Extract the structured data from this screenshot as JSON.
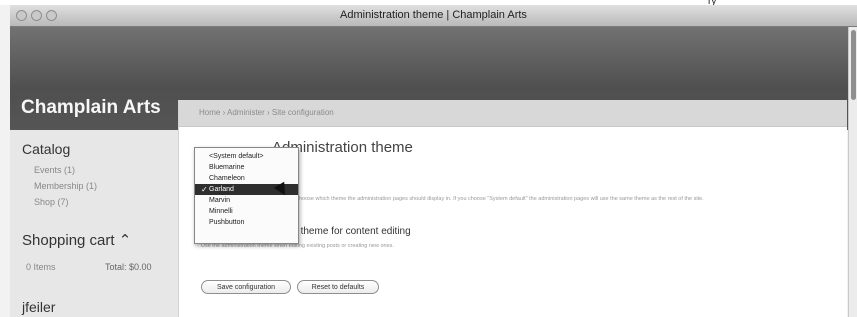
{
  "window": {
    "corner_label": "ry",
    "title": "Administration theme | Champlain Arts"
  },
  "site": {
    "name": "Champlain Arts"
  },
  "breadcrumb": "Home › Administer › Site configuration",
  "page": {
    "title": "Administration theme",
    "select_description": "Choose which theme the administration pages should display in. If you choose \"System default\" the administration pages will use the same theme as the rest of the site."
  },
  "sidebar": {
    "catalog_title": "Catalog",
    "catalog_links": [
      "Events (1)",
      "Membership (1)",
      "Shop (7)"
    ],
    "cart_title": "Shopping cart ⌃",
    "cart_items": "0 Items",
    "cart_total": "Total: $0.00",
    "user_name": "jfeiler"
  },
  "theme_options": [
    "<System default>",
    "Bluemarine",
    "Chameleon",
    "Garland",
    "Marvin",
    "Minnelli",
    "Pushbutton"
  ],
  "selected_option": "Garland",
  "checkbox": {
    "label": "Use administration theme for content editing",
    "description": "Use the administration theme when editing existing posts or creating new ones."
  },
  "buttons": {
    "save": "Save configuration",
    "reset": "Reset to defaults"
  }
}
